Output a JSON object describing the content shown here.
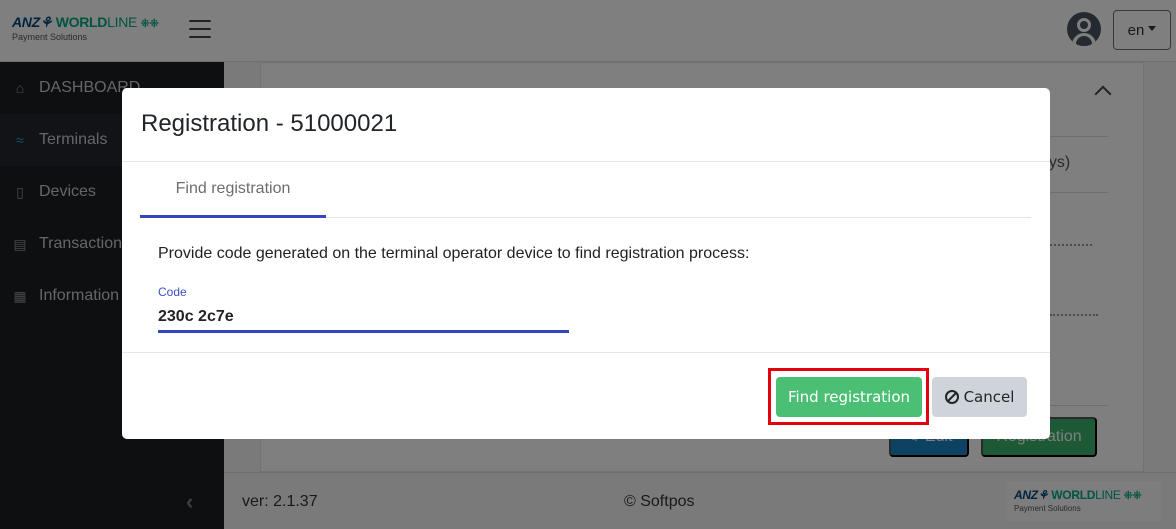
{
  "header": {
    "logo": {
      "brand_primary": "ANZ",
      "brand_secondary": "WORLD",
      "brand_secondary_light": "LINE",
      "tagline": "Payment Solutions"
    },
    "menu_icon": "hamburger-icon",
    "user_icon": "user-circle-icon",
    "language": "en"
  },
  "sidebar": {
    "items": [
      {
        "label": "DASHBOARD",
        "icon": "home-icon",
        "active": false
      },
      {
        "label": "Terminals",
        "icon": "wifi-icon",
        "active": true
      },
      {
        "label": "Devices",
        "icon": "mobile-icon",
        "active": false
      },
      {
        "label": "Transactions",
        "icon": "credit-card-icon",
        "active": false
      },
      {
        "label": "Information",
        "icon": "id-card-icon",
        "active": false
      }
    ],
    "collapse_icon": "chevron-left-icon"
  },
  "background": {
    "partial_text": "ays)",
    "edit_label": "Edit",
    "registration_label": "Registration"
  },
  "footer": {
    "version": "ver: 2.1.37",
    "copyright": "© Softpos"
  },
  "modal": {
    "title": "Registration - 51000021",
    "tab_label": "Find registration",
    "prompt": "Provide code generated on the terminal operator device to find registration process:",
    "code_label": "Code",
    "code_value": "230c 2c7e",
    "find_button": "Find registration",
    "cancel_button": "Cancel"
  },
  "colors": {
    "accent_blue": "#3346c1",
    "success_green": "#4bbf73",
    "highlight_red": "#e3000f",
    "sidebar_bg": "#1c1f23",
    "active_icon": "#27a3d9"
  }
}
